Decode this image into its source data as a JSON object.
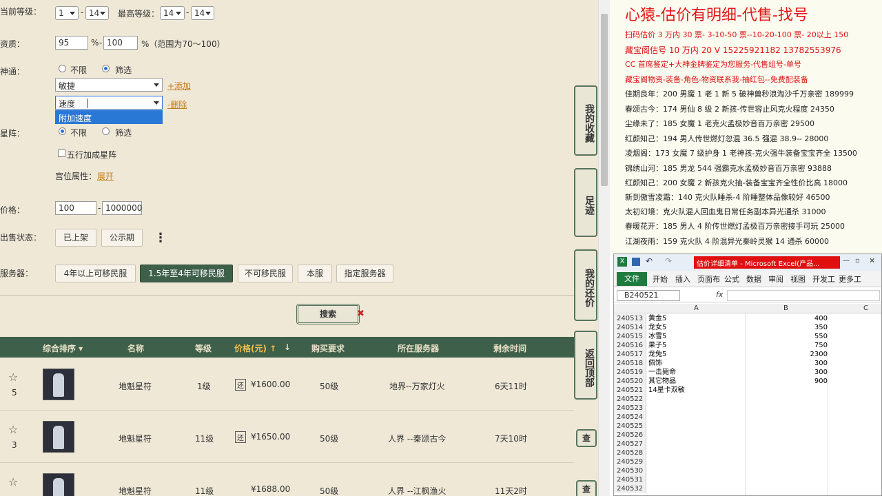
{
  "filter": {
    "level_label": "当前等级：",
    "level_from": "1",
    "level_to": "14",
    "max_level_label": "最高等级：",
    "max_from": "14",
    "max_to": "14",
    "aptitude_label": "资质：",
    "aptitude_from": "95",
    "aptitude_to": "100",
    "aptitude_hint": "%（范围为70～100）",
    "percent_sign": "%",
    "shentong_label": "神通：",
    "opt_unlimited": "不限",
    "opt_filter": "筛选",
    "shentong_select1": "敏捷",
    "add_link": "+添加",
    "shentong_input2": "速度",
    "delete_link": "-删除",
    "dropdown_suggestion": "附加速度",
    "xingzhen_label": "星阵：",
    "wuxing_label": "五行加成星阵",
    "gongwei_label": "宫位属性：",
    "expand_link": "展开",
    "price_label": "价格：",
    "price_from": "100",
    "price_to": "1000000",
    "status_label": "出售状态：",
    "status_btns": [
      "已上架",
      "公示期"
    ],
    "more_glyph": "⋮",
    "server_label": "服务器：",
    "server_btns": [
      "4年以上可移民服",
      "1.5年至4年可移民服",
      "不可移民服",
      "本服",
      "指定服务器"
    ],
    "search_btn": "搜索",
    "close_glyph": "✖",
    "dash": "-"
  },
  "side_buttons": [
    "我的收藏",
    "足迹",
    "我的还价",
    "返回顶部"
  ],
  "table": {
    "headers": [
      "综合排序 ▾",
      "名称",
      "等级",
      "价格(元) ↑",
      "↓",
      "购买要求",
      "所在服务器",
      "剩余时间"
    ],
    "rows": [
      {
        "fav": "5",
        "name": "地魁星符",
        "level": "1级",
        "price_tag": "还",
        "price": "¥1600.00",
        "req": "50级",
        "server": "地界--万家灯火",
        "time": "6天11时",
        "action": ""
      },
      {
        "fav": "3",
        "name": "地魁星符",
        "level": "11级",
        "price_tag": "还",
        "price": "¥1650.00",
        "req": "50级",
        "server": "人界 --秦颂古今",
        "time": "7天10时",
        "action": "查"
      },
      {
        "fav": "",
        "name": "地魁星符",
        "level": "11级",
        "price_tag": "",
        "price": "¥1688.00",
        "req": "50级",
        "server": "人界 --江枫渔火",
        "time": "11天2时",
        "action": "查"
      }
    ]
  },
  "notes": {
    "title": "心猿-估价有明细-代售-找号",
    "lines": [
      {
        "text": "扫码估价 3 万内 30 票- 3-10-50 票--10-20-100 票- 20以上 150",
        "color": "#d11"
      },
      {
        "text": "藏宝阁估号 10 万内 20 V 15225921182    13782553976",
        "color": "#d11"
      },
      {
        "text": "CC 首席鉴定+大神金牌鉴定为您服务-代售组号-单号",
        "color": "#d11"
      },
      {
        "text": "藏宝阁物资-装备-角色-物资联系我-抽红包--免费配装备",
        "color": "#d11"
      },
      {
        "text": "佳期良年：200 男魔 1 老 1 新 5 破神兽秒浪淘沙千万亲密 189999",
        "color": "#222"
      },
      {
        "text": "春颂古今：174 男仙 8 级 2 新孩-传世容止风克火程度 24350",
        "color": "#222"
      },
      {
        "text": "尘缘未了：185 女魔 1 老克火孟极妙音百万亲密 29500",
        "color": "#222"
      },
      {
        "text": "红颜知己：194 男人传世燃灯忽混 36.5 强混 38.9-- 28000",
        "color": "#222"
      },
      {
        "text": "凌烟阁：173 女魔 7 级护身 1 老神孩-克火强牛装备宝宝齐全 13500",
        "color": "#222"
      },
      {
        "text": "锦绣山河：185 男龙 544 强霸克水孟极妙音百万亲密 93888",
        "color": "#222"
      },
      {
        "text": "红颜知己：200 女魔 2 新孩克火抽-装备宝宝齐全性价比高 18000",
        "color": "#222"
      },
      {
        "text": "新到傲雪凌霜：140 克火队睡杀-4 阶睡整体品像较好 46500",
        "color": "#222"
      },
      {
        "text": "太初幻境：克火队混人回血鬼日常任务副本异光通杀 31000",
        "color": "#222"
      },
      {
        "text": "春暖花开：185 男人 4 阶传世燃灯孟极百万亲密接手可玩 25000",
        "color": "#222"
      },
      {
        "text": "江湖夜雨：159 克火队 4 阶混异光秦岭灵猴 14 通杀 60000",
        "color": "#222"
      }
    ]
  },
  "excel": {
    "title": "估价详细清单 - Microsoft Excel(产品...",
    "tabs": [
      "文件",
      "开始",
      "插入",
      "页面布",
      "公式",
      "数据",
      "审阅",
      "视图",
      "开发工",
      "更多工"
    ],
    "name_box": "B240521",
    "fx": "fx",
    "col_headers": [
      "A",
      "B",
      "C"
    ],
    "rows": [
      {
        "num": "240513",
        "a": "黄金5",
        "b": "400"
      },
      {
        "num": "240514",
        "a": "龙女5",
        "b": "350"
      },
      {
        "num": "240515",
        "a": "冰雪5",
        "b": "550"
      },
      {
        "num": "240516",
        "a": "果子5",
        "b": "750"
      },
      {
        "num": "240517",
        "a": "龙兔5",
        "b": "2300"
      },
      {
        "num": "240518",
        "a": "佩饰",
        "b": "300"
      },
      {
        "num": "240519",
        "a": "一击毙命",
        "b": "300"
      },
      {
        "num": "240520",
        "a": "其它物品",
        "b": "900"
      },
      {
        "num": "240521",
        "a": "14星卡双敏",
        "b": ""
      },
      {
        "num": "240522",
        "a": "",
        "b": ""
      },
      {
        "num": "240523",
        "a": "",
        "b": ""
      },
      {
        "num": "240524",
        "a": "",
        "b": ""
      },
      {
        "num": "240525",
        "a": "",
        "b": ""
      },
      {
        "num": "240526",
        "a": "",
        "b": ""
      },
      {
        "num": "240527",
        "a": "",
        "b": ""
      },
      {
        "num": "240528",
        "a": "",
        "b": ""
      },
      {
        "num": "240529",
        "a": "",
        "b": ""
      },
      {
        "num": "240530",
        "a": "",
        "b": ""
      },
      {
        "num": "240531",
        "a": "",
        "b": ""
      },
      {
        "num": "240532",
        "a": "",
        "b": ""
      }
    ]
  }
}
